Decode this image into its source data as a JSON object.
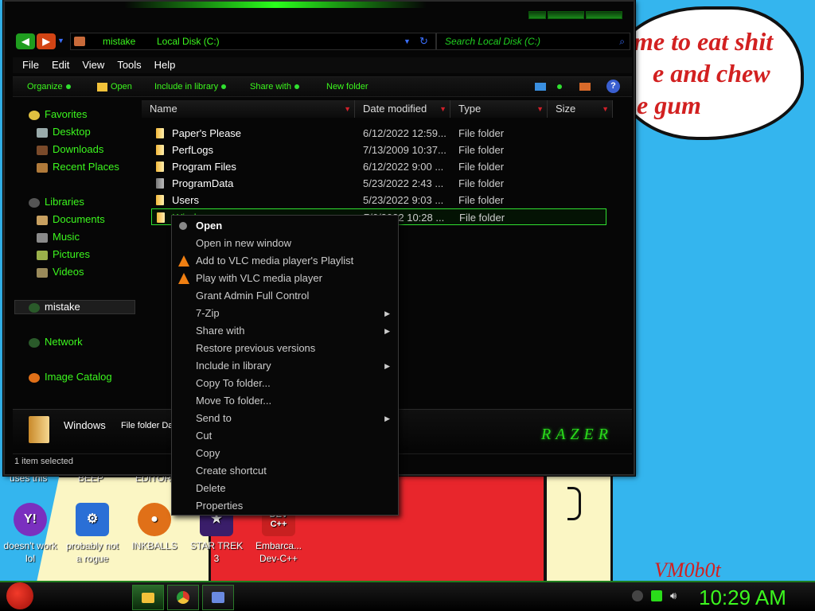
{
  "wallpaper": {
    "text_lines": [
      "me to eat shit",
      "e and chew",
      "e gum"
    ],
    "signature": "VM0b0t"
  },
  "desktop_icons_top_labels": [
    "uses this",
    "BEEP",
    "EDITOR"
  ],
  "desktop_icons": [
    {
      "label": "doesn't work lol",
      "icon": "yahoo-messenger-icon",
      "color": "#7a2fbf"
    },
    {
      "label": "probably not a rogue",
      "icon": "gears-program-icon",
      "color": "#2a6fd6"
    },
    {
      "label": "INKBALLS",
      "icon": "inkballs-icon",
      "color": "#e07018"
    },
    {
      "label": "STAR TREK 3",
      "icon": "star-trek-icon",
      "color": "#3a1e6a"
    },
    {
      "label": "Embarca... Dev-C++",
      "icon": "dev-cpp-icon",
      "color": "#c82020",
      "glyph": "DEV C++"
    }
  ],
  "explorer": {
    "address": {
      "crumb1": "mistake",
      "crumb2": "Local Disk (C:)"
    },
    "search_placeholder": "Search Local Disk (C:)",
    "menu": [
      "File",
      "Edit",
      "View",
      "Tools",
      "Help"
    ],
    "toolbar": {
      "organize": "Organize",
      "open": "Open",
      "include": "Include in library",
      "share": "Share with",
      "new_folder": "New folder",
      "help": "?"
    },
    "nav": {
      "favorites": "Favorites",
      "desktop": "Desktop",
      "downloads": "Downloads",
      "recent": "Recent Places",
      "libraries": "Libraries",
      "documents": "Documents",
      "music": "Music",
      "pictures": "Pictures",
      "videos": "Videos",
      "homegroup": "mistake",
      "network": "Network",
      "image_catalog": "Image Catalog"
    },
    "columns": {
      "name": "Name",
      "date": "Date modified",
      "type": "Type",
      "size": "Size"
    },
    "files": [
      {
        "name": "Paper's Please",
        "date": "6/12/2022 12:59...",
        "type": "File folder"
      },
      {
        "name": "PerfLogs",
        "date": "7/13/2009 10:37...",
        "type": "File folder"
      },
      {
        "name": "Program Files",
        "date": "6/12/2022 9:00 ...",
        "type": "File folder"
      },
      {
        "name": "ProgramData",
        "date": "5/23/2022 2:43 ...",
        "type": "File folder"
      },
      {
        "name": "Users",
        "date": "5/23/2022 9:03 ...",
        "type": "File folder"
      },
      {
        "name": "Windows",
        "date": "7/6/2022 10:28 ...",
        "type": "File folder"
      }
    ],
    "details": {
      "name": "Windows",
      "text": "File folder Date m"
    },
    "brand": "RAZER",
    "status": "1 item selected"
  },
  "context_menu": [
    {
      "label": "Open",
      "bold": true,
      "icon": "open-icon"
    },
    {
      "label": "Open in new window"
    },
    {
      "label": "Add to VLC media player's Playlist",
      "icon": "vlc-icon"
    },
    {
      "label": "Play with VLC media player",
      "icon": "vlc-icon"
    },
    {
      "label": "Grant Admin Full Control"
    },
    {
      "label": "7-Zip",
      "submenu": true
    },
    {
      "label": "Share with",
      "submenu": true
    },
    {
      "label": "Restore previous versions"
    },
    {
      "label": "Include in library",
      "submenu": true
    },
    {
      "label": "Copy To folder..."
    },
    {
      "label": "Move To folder..."
    },
    {
      "label": "Send to",
      "submenu": true
    },
    {
      "label": "Cut"
    },
    {
      "label": "Copy"
    },
    {
      "label": "Create shortcut"
    },
    {
      "label": "Delete"
    },
    {
      "label": "Properties"
    }
  ],
  "taskbar": {
    "clock": "10:29 AM",
    "buttons": [
      "explorer-taskbar-icon",
      "chrome-taskbar-icon",
      "control-panel-taskbar-icon"
    ]
  },
  "colors": {
    "accent": "#3cf81e",
    "window_bg": "#060606",
    "desktop": "#34b5ee"
  }
}
